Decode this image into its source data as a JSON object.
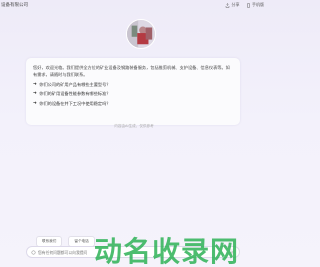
{
  "header": {
    "company": "设备有限公司",
    "share_label": "分享",
    "phone_label": "手机版"
  },
  "card": {
    "greeting": "您好，欢迎光临。我们提供全方位的矿业设备及钢路装备服务，包括推剪机械、支护设备、信息仪表等。如有需求，请随时与我们联系。",
    "suggestions": [
      "你们公司的矿用产品有哪些主要型号？",
      "你们的矿用设备性能参数有哪些标准？",
      "你们的设备在井下工况中使用稳定吗？"
    ]
  },
  "generated_note": "内容由AI生成，仅供参考",
  "chips": [
    "联系我们",
    "留个电话"
  ],
  "input": {
    "placeholder": "您有任何问题都可以向我提问"
  },
  "watermark": "动名收录网",
  "colors": {
    "watermark": "#2eb256",
    "background": "#eeebf8"
  }
}
